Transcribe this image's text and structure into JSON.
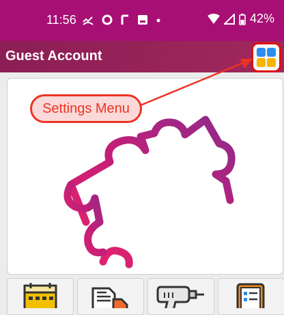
{
  "status_bar": {
    "time": "11:56",
    "battery": "42%",
    "icons": [
      "missed-call-icon",
      "sync-icon",
      "r-icon",
      "message-icon",
      "dot-icon",
      "wifi-icon",
      "signal-icon",
      "battery-icon"
    ]
  },
  "app_bar": {
    "title": "Guest Account",
    "settings_icon": "grid-icon"
  },
  "annotation": {
    "label": "Settings Menu"
  },
  "bottom_buttons": [
    {
      "icon": "calendar-icon"
    },
    {
      "icon": "documents-icon"
    },
    {
      "icon": "drill-icon"
    },
    {
      "icon": "checklist-icon"
    }
  ],
  "colors": {
    "status_bar": "#a80f74",
    "app_bar": "#8c1e55",
    "accent_red": "#e32",
    "grid_blue": "#2a8df2",
    "grid_yellow": "#f7b500"
  }
}
